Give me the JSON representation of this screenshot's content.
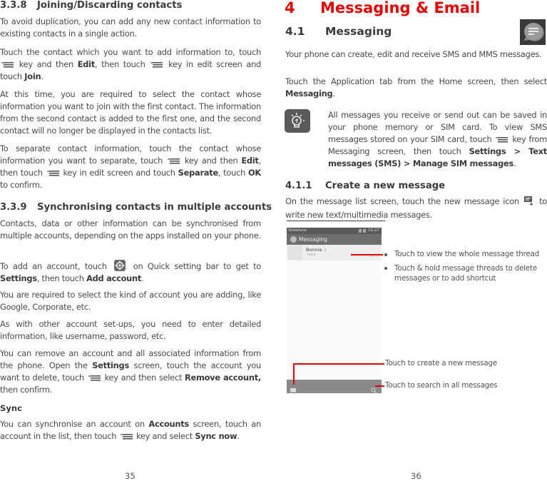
{
  "left_page": {
    "section_338": {
      "number": "3.3.8",
      "title": "Joining/Discarding contacts"
    },
    "p1": "To avoid duplication, you can add any new contact information to existing contacts in a single action.",
    "p2": {
      "a": "Touch the contact which you want to add information to, touch",
      "b": "key and then",
      "edit": "Edit",
      "c": ", then touch",
      "d": "key in edit screen and touch",
      "join": "Join",
      "e": "."
    },
    "p3": "At this time, you are required to select the contact whose information you want to join with the first contact. The information from the second contact is added to the first one, and the second contact will no longer be displayed in the contacts list.",
    "p4": {
      "a": "To separate contact information, touch the contact whose information you want to separate, touch",
      "b": "key and then",
      "edit": "Edit",
      "c": ", then touch",
      "d": "key in edit screen and touch",
      "separate": "Separate",
      "e": ", touch",
      "ok": "OK",
      "f": "to confirm."
    },
    "section_339": {
      "number": "3.3.9",
      "title": "Synchronising contacts in multiple accounts"
    },
    "p5": "Contacts, data or other information can be synchronised from multiple accounts, depending on the apps installed on your phone.",
    "p6": {
      "a": "To add an account, touch",
      "b": "on Quick setting bar to get to",
      "settings": "Settings",
      "c": ", then touch",
      "add_account": "Add account",
      "d": "."
    },
    "p7": "You are required to select the kind of account you are adding, like Google, Corporate, etc.",
    "p8": "As with other account set-ups, you need to enter detailed information, like username, password, etc.",
    "p9": {
      "a": "You can remove an account and all associated information from the phone. Open the",
      "settings": "Settings",
      "b": "screen, touch the account you want to delete, touch",
      "c": "key and then select",
      "remove": "Remove account,",
      "d": "then confirm."
    },
    "sync_heading": "Sync",
    "p10": {
      "a": "You can synchronise an account on",
      "accounts": "Accounts",
      "b": "screen, touch an account in the list, then touch",
      "c": "key and select",
      "sync_now": "Sync now",
      "d": "."
    },
    "page_number": "35"
  },
  "right_page": {
    "chapter": {
      "number": "4",
      "title": "Messaging & Email"
    },
    "section_41": {
      "number": "4.1",
      "title": "Messaging"
    },
    "p1": "Your phone can create, edit and receive SMS and MMS messages.",
    "p2": {
      "a": "Touch the Application tab from the Home screen, then select",
      "messaging": "Messaging",
      "b": "."
    },
    "tip": {
      "a": "All messages you receive or send out can be saved in your phone memory or SIM card. To view SMS messages stored on your SIM card, touch",
      "b": "key from Messaging screen, then touch",
      "path": "Settings > Text messages (SMS) > Manage SIM messages",
      "c": "."
    },
    "section_411": {
      "number": "4.1.1",
      "title": "Create a new message"
    },
    "p3": {
      "a": "On the message list screen, touch the new message icon",
      "b": "to write new text/multimedia messages."
    },
    "phone": {
      "carrier": "Vodafone",
      "time": "15:27",
      "app_title": "Messaging",
      "thread": {
        "name": "Bonnie",
        "count": "2",
        "preview": "Hello",
        "date": "15/11"
      }
    },
    "callouts": {
      "thread_view": "Touch to view the whole message thread",
      "thread_hold": "Touch & hold message threads to delete messages or to add shortcut",
      "new_message": "Touch to create a new message",
      "search": "Touch to search in all messages"
    },
    "page_number": "36"
  },
  "colors": {
    "accent_red": "#e60000",
    "body_text": "#4a4a4a",
    "phone_bar": "#6e6e6e"
  }
}
